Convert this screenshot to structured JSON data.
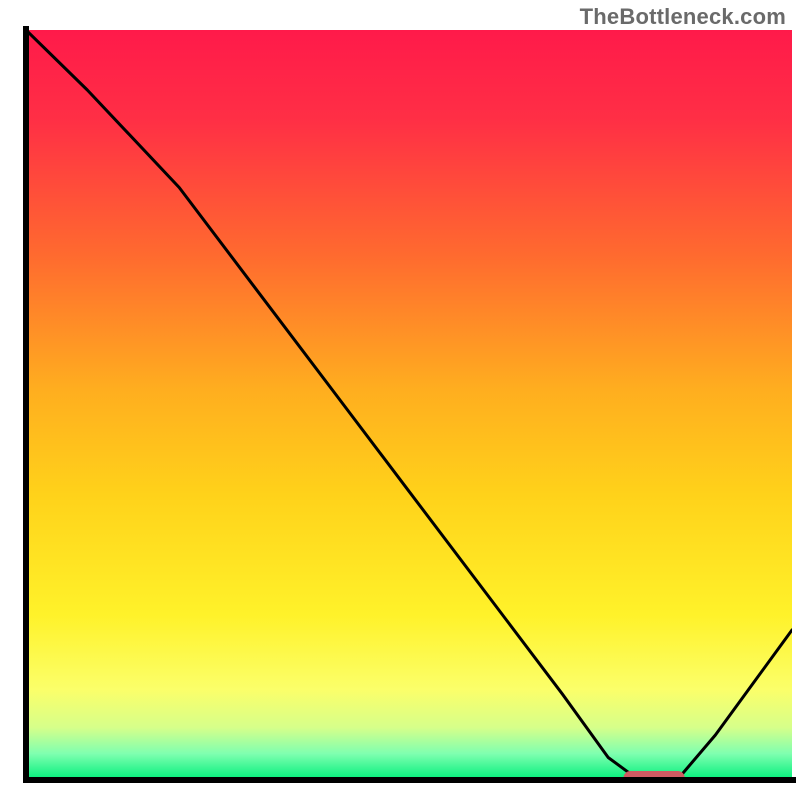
{
  "watermark": "TheBottleneck.com",
  "colors": {
    "axis": "#000000",
    "curve": "#000000",
    "marker_fill": "#cf5b62",
    "gradient_stops": [
      {
        "offset": 0.0,
        "color": "#ff1a4a"
      },
      {
        "offset": 0.12,
        "color": "#ff2f45"
      },
      {
        "offset": 0.3,
        "color": "#ff6a2f"
      },
      {
        "offset": 0.48,
        "color": "#ffae1f"
      },
      {
        "offset": 0.62,
        "color": "#ffd21a"
      },
      {
        "offset": 0.78,
        "color": "#fff22a"
      },
      {
        "offset": 0.88,
        "color": "#fbff6a"
      },
      {
        "offset": 0.93,
        "color": "#d6ff8a"
      },
      {
        "offset": 0.965,
        "color": "#7fffb0"
      },
      {
        "offset": 1.0,
        "color": "#00ef7a"
      }
    ]
  },
  "chart_data": {
    "type": "line",
    "title": "",
    "xlabel": "",
    "ylabel": "",
    "xlim": [
      0,
      100
    ],
    "ylim": [
      0,
      100
    ],
    "grid": false,
    "legend": false,
    "series": [
      {
        "name": "bottleneck-curve",
        "x": [
          0,
          8,
          20,
          30,
          40,
          50,
          60,
          70,
          76,
          80,
          85,
          90,
          95,
          100
        ],
        "y": [
          100,
          92,
          79,
          65.5,
          52,
          38.5,
          25,
          11.5,
          3,
          0,
          0,
          6,
          13,
          20
        ]
      }
    ],
    "marker": {
      "x_start": 78,
      "x_end": 86,
      "y": 0
    }
  }
}
